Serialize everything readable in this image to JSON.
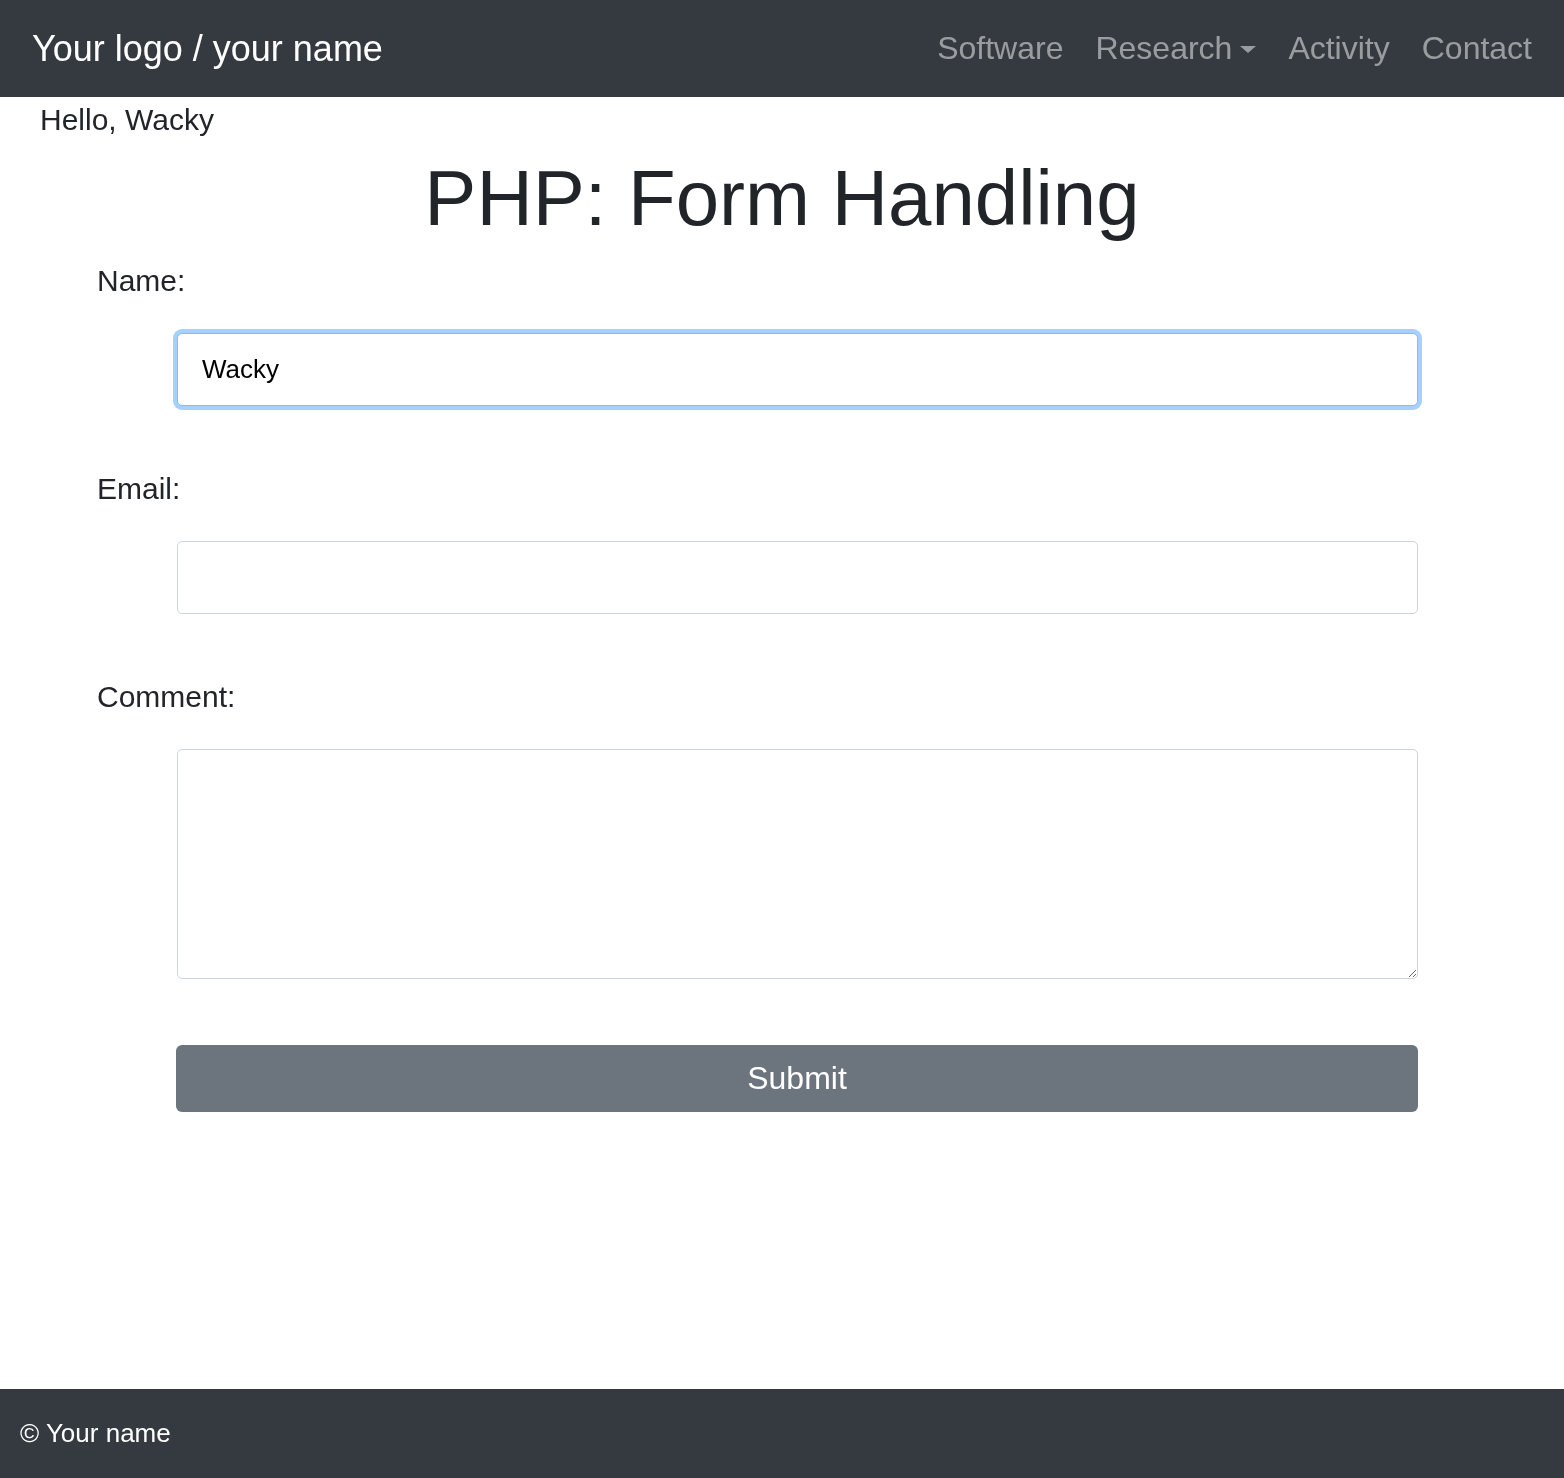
{
  "navbar": {
    "brand": "Your logo / your name",
    "links": [
      {
        "label": "Software",
        "dropdown": false
      },
      {
        "label": "Research",
        "dropdown": true
      },
      {
        "label": "Activity",
        "dropdown": false
      },
      {
        "label": "Contact",
        "dropdown": false
      }
    ]
  },
  "greeting": "Hello, Wacky",
  "title": "PHP: Form Handling",
  "form": {
    "fields": [
      {
        "kind": "input",
        "label": "Name:",
        "value": "Wacky",
        "focused": true
      },
      {
        "kind": "input",
        "label": "Email:",
        "focused": false
      },
      {
        "kind": "textarea",
        "label": "Comment:",
        "focused": false
      }
    ],
    "submit": "Submit"
  },
  "footer": {
    "text": "© Your name"
  }
}
